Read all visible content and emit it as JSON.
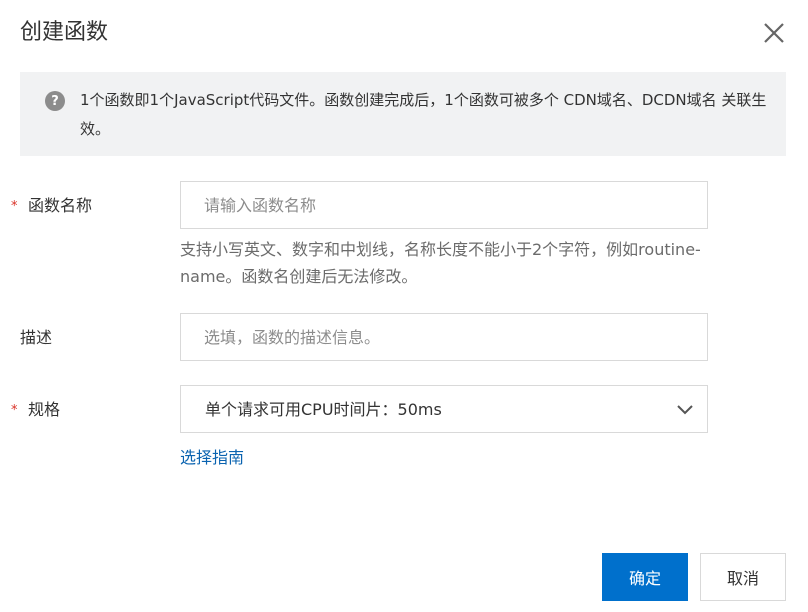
{
  "dialog": {
    "title": "创建函数",
    "close_icon": "close-icon"
  },
  "notice": {
    "icon": "question-circle-icon",
    "text": "1个函数即1个JavaScript代码文件。函数创建完成后，1个函数可被多个 CDN域名、DCDN域名 关联生效。"
  },
  "form": {
    "name": {
      "required_mark": "*",
      "label": "函数名称",
      "placeholder": "请输入函数名称",
      "value": "",
      "hint": "支持小写英文、数字和中划线，名称长度不能小于2个字符，例如routine-name。函数名创建后无法修改。"
    },
    "description": {
      "label": "描述",
      "placeholder": "选填，函数的描述信息。",
      "value": ""
    },
    "spec": {
      "required_mark": "*",
      "label": "规格",
      "selected": "单个请求可用CPU时间片：50ms",
      "icon": "chevron-down-icon",
      "guide_link": "选择指南"
    }
  },
  "footer": {
    "confirm_label": "确定",
    "cancel_label": "取消"
  },
  "colors": {
    "primary": "#0070cc",
    "link": "#0a63b0",
    "required": "#d93026",
    "notice_bg": "#f1f2f3"
  }
}
